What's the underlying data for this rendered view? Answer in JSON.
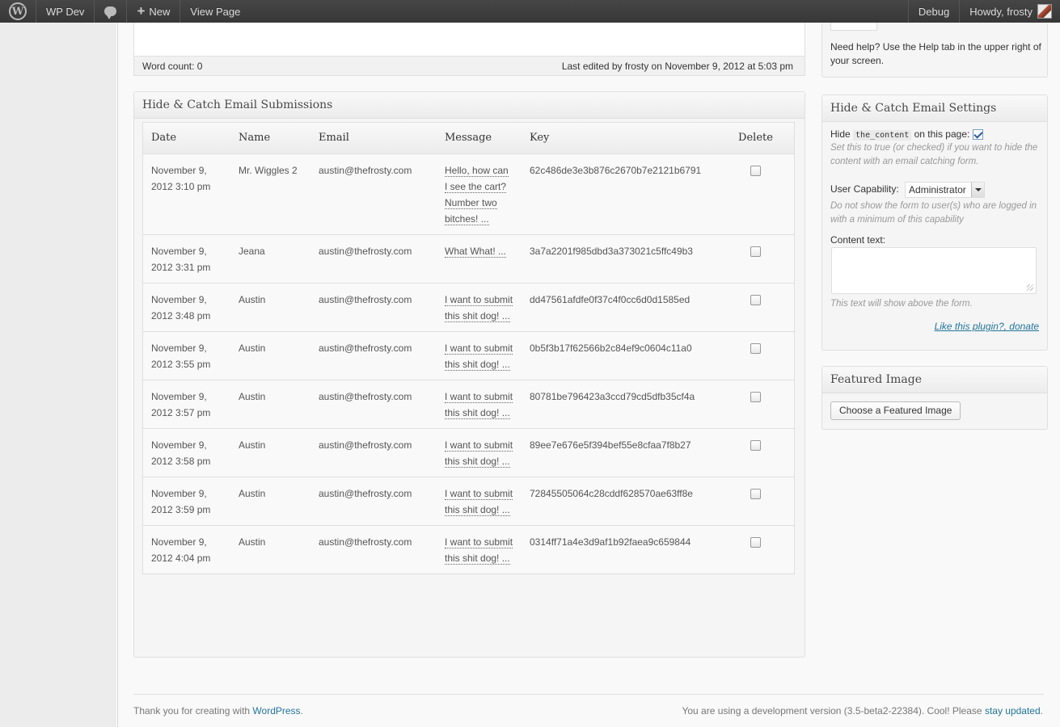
{
  "admin_bar": {
    "site_name": "WP Dev",
    "new_label": "New",
    "view_page": "View Page",
    "debug": "Debug",
    "howdy": "Howdy, frosty"
  },
  "editor": {
    "word_count": "Word count: 0",
    "last_edited": "Last edited by frosty on November 9, 2012 at 5:03 pm"
  },
  "submissions": {
    "title": "Hide & Catch Email Submissions",
    "columns": [
      "Date",
      "Name",
      "Email",
      "Message",
      "Key",
      "Delete"
    ],
    "rows": [
      {
        "date": "November 9, 2012 3:10 pm",
        "name": "Mr. Wiggles 2",
        "email": "austin@thefrosty.com",
        "message": "Hello, how can I see the cart? Number two bitches! ...",
        "key": "62c486de3e3b876c2670b7e2121b6791"
      },
      {
        "date": "November 9, 2012 3:31 pm",
        "name": "Jeana",
        "email": "austin@thefrosty.com",
        "message": "What What! ...",
        "key": "3a7a2201f985dbd3a373021c5ffc49b3"
      },
      {
        "date": "November 9, 2012 3:48 pm",
        "name": "Austin",
        "email": "austin@thefrosty.com",
        "message": "I want to submit this shit dog! ...",
        "key": "dd47561afdfe0f37c4f0cc6d0d1585ed"
      },
      {
        "date": "November 9, 2012 3:55 pm",
        "name": "Austin",
        "email": "austin@thefrosty.com",
        "message": "I want to submit this shit dog! ...",
        "key": "0b5f3b17f62566b2c84ef9c0604c11a0"
      },
      {
        "date": "November 9, 2012 3:57 pm",
        "name": "Austin",
        "email": "austin@thefrosty.com",
        "message": "I want to submit this shit dog! ...",
        "key": "80781be796423a3ccd79cd5dfb35cf4a"
      },
      {
        "date": "November 9, 2012 3:58 pm",
        "name": "Austin",
        "email": "austin@thefrosty.com",
        "message": "I want to submit this shit dog! ...",
        "key": "89ee7e676e5f394bef55e8cfaa7f8b27"
      },
      {
        "date": "November 9, 2012 3:59 pm",
        "name": "Austin",
        "email": "austin@thefrosty.com",
        "message": "I want to submit this shit dog! ...",
        "key": "72845505064c28cddf628570ae63ff8e"
      },
      {
        "date": "November 9, 2012 4:04 pm",
        "name": "Austin",
        "email": "austin@thefrosty.com",
        "message": "I want to submit this shit dog! ...",
        "key": "0314ff71a4e3d9af1b92faea9c659844"
      }
    ]
  },
  "help": {
    "text": "Need help? Use the Help tab in the upper right of your screen."
  },
  "settings": {
    "title": "Hide & Catch Email Settings",
    "hide_prefix": "Hide",
    "hide_code": "the_content",
    "hide_suffix": "on this page:",
    "hide_desc": "Set this to true (or checked) if you want to hide the content with an email catching form.",
    "capability_label": "User Capability:",
    "capability_value": "Administrator",
    "capability_desc": "Do not show the form to user(s) who are logged in with a minimum of this capability",
    "content_text_label": "Content text:",
    "content_text_desc": "This text will show above the form.",
    "donate_link": "Like this plugin?, donate"
  },
  "featured_image": {
    "title": "Featured Image",
    "button": "Choose a Featured Image"
  },
  "footer": {
    "left_text": "Thank you for creating with",
    "left_link": "WordPress",
    "right_text": "You are using a development version (3.5-beta2-22384). Cool! Please",
    "right_link": "stay updated"
  }
}
